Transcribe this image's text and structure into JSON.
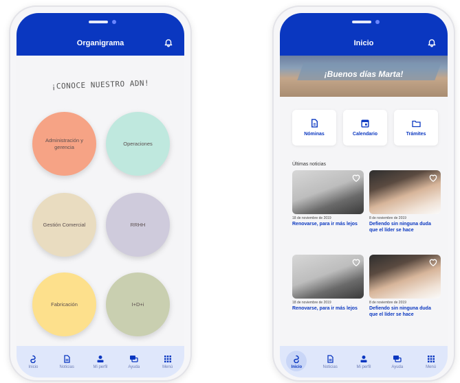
{
  "left_screen": {
    "title": "Organigrama",
    "heading": "¡CONOCE NUESTRO ADN!",
    "departments": [
      {
        "label": "Administración y gerencia",
        "color": "#f6a385"
      },
      {
        "label": "Operaciones",
        "color": "#bfe8de"
      },
      {
        "label": "Gestión Comercial",
        "color": "#e9dcc0"
      },
      {
        "label": "RRHH",
        "color": "#cfcbdc"
      },
      {
        "label": "Fabricación",
        "color": "#fde08c"
      },
      {
        "label": "I+D+i",
        "color": "#c9cfb0"
      }
    ]
  },
  "right_screen": {
    "title": "Inicio",
    "greeting": "¡Buenos días Marta!",
    "quick_links": [
      "Nóminas",
      "Calendario",
      "Trámites"
    ],
    "news_section": "Últimas noticias",
    "news": [
      {
        "date": "18 de noviembre de 2019",
        "title": "Renovarse, para ir más lejos",
        "image": "laptop"
      },
      {
        "date": "8 de noviembre de 2019",
        "title": "Defiendo sin ninguna duda que el líder se hace",
        "image": "hands"
      },
      {
        "date": "18 de noviembre de 2019",
        "title": "Renovarse, para ir más lejos",
        "image": "laptop"
      },
      {
        "date": "8 de noviembre de 2019",
        "title": "Defiendo sin ninguna duda que el líder se hace",
        "image": "hands"
      }
    ]
  },
  "nav": {
    "items": [
      "Inicio",
      "Noticias",
      "Mi perfil",
      "Ayuda",
      "Menú"
    ],
    "icons": [
      "home-swirl-icon",
      "document-icon",
      "person-icon",
      "chat-icon",
      "grid-icon"
    ]
  },
  "colors": {
    "brand": "#0a37c0",
    "nav_bg": "#dfe7fb"
  }
}
